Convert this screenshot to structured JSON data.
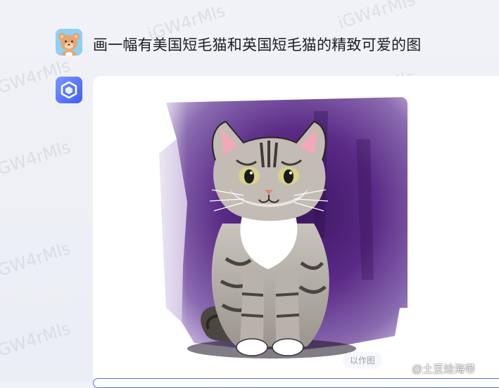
{
  "conversation": {
    "user_message": "画一幅有美国短毛猫和英国短毛猫的精致可爱的图",
    "image_action_label": "以作图"
  },
  "watermark": {
    "text": "iGW4rMls"
  },
  "credit": {
    "text": "@土豆烩海带"
  },
  "icons": {
    "user_avatar": "bear-avatar-icon",
    "bot_avatar": "assistant-cube-icon",
    "weibo": "weibo-logo-icon"
  },
  "colors": {
    "page_bg": "#eef0f6",
    "card_bg": "#ffffff",
    "accent": "#5b6cf0",
    "watercolor_purple": "#5b2a86"
  }
}
